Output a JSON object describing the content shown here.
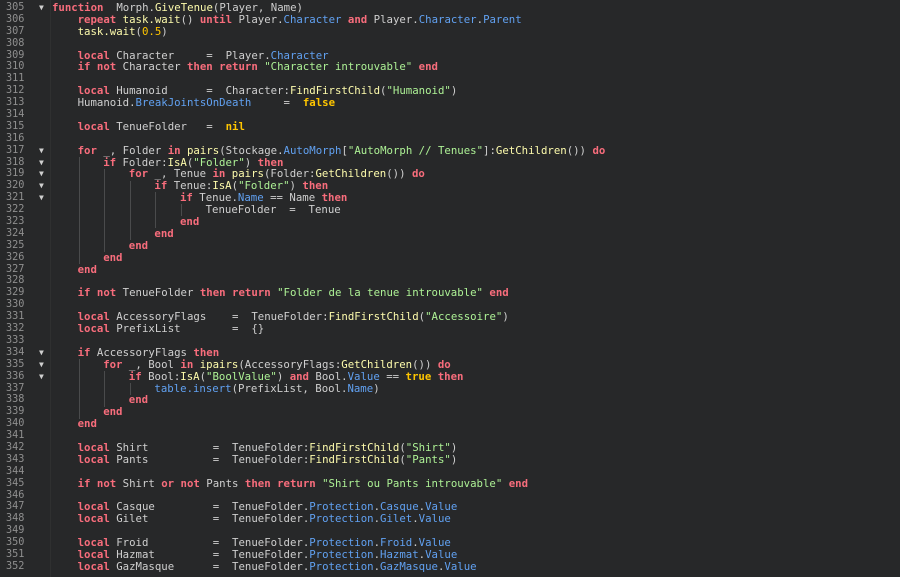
{
  "editor": {
    "lines": [
      {
        "n": "305",
        "fold": true,
        "indent": 0,
        "t": [
          [
            "kw",
            "function"
          ],
          [
            "",
            "  Morph."
          ],
          [
            "fn",
            "GiveTenue"
          ],
          [
            "",
            "(Player, Name)"
          ]
        ]
      },
      {
        "n": "306",
        "fold": false,
        "indent": 1,
        "t": [
          [
            "kw",
            "repeat"
          ],
          [
            "",
            " "
          ],
          [
            "fn",
            "task.wait"
          ],
          [
            "",
            "() "
          ],
          [
            "kw",
            "until"
          ],
          [
            "",
            " Player."
          ],
          [
            "prop",
            "Character"
          ],
          [
            "",
            " "
          ],
          [
            "kw",
            "and"
          ],
          [
            "",
            " Player."
          ],
          [
            "prop",
            "Character"
          ],
          [
            "",
            "."
          ],
          [
            "prop",
            "Parent"
          ]
        ]
      },
      {
        "n": "307",
        "fold": false,
        "indent": 1,
        "t": [
          [
            "fn",
            "task.wait"
          ],
          [
            "",
            "("
          ],
          [
            "num",
            "0.5"
          ],
          [
            "",
            ")"
          ]
        ]
      },
      {
        "n": "308",
        "fold": false,
        "indent": 0,
        "t": []
      },
      {
        "n": "309",
        "fold": false,
        "indent": 1,
        "t": [
          [
            "kw",
            "local"
          ],
          [
            "",
            " Character     =  Player."
          ],
          [
            "prop",
            "Character"
          ]
        ]
      },
      {
        "n": "310",
        "fold": false,
        "indent": 1,
        "t": [
          [
            "kw",
            "if not"
          ],
          [
            "",
            " Character "
          ],
          [
            "kw",
            "then return"
          ],
          [
            "",
            " "
          ],
          [
            "str",
            "\"Character introuvable\""
          ],
          [
            "",
            " "
          ],
          [
            "kw",
            "end"
          ]
        ]
      },
      {
        "n": "311",
        "fold": false,
        "indent": 0,
        "t": []
      },
      {
        "n": "312",
        "fold": false,
        "indent": 1,
        "t": [
          [
            "kw",
            "local"
          ],
          [
            "",
            " Humanoid      =  Character:"
          ],
          [
            "fn",
            "FindFirstChild"
          ],
          [
            "",
            "("
          ],
          [
            "str",
            "\"Humanoid\""
          ],
          [
            "",
            ")"
          ]
        ]
      },
      {
        "n": "313",
        "fold": false,
        "indent": 1,
        "t": [
          [
            "",
            "Humanoid."
          ],
          [
            "prop",
            "BreakJointsOnDeath"
          ],
          [
            "",
            "     =  "
          ],
          [
            "bool",
            "false"
          ]
        ]
      },
      {
        "n": "314",
        "fold": false,
        "indent": 0,
        "t": []
      },
      {
        "n": "315",
        "fold": false,
        "indent": 1,
        "t": [
          [
            "kw",
            "local"
          ],
          [
            "",
            " TenueFolder   =  "
          ],
          [
            "bool",
            "nil"
          ]
        ]
      },
      {
        "n": "316",
        "fold": false,
        "indent": 0,
        "t": []
      },
      {
        "n": "317",
        "fold": true,
        "indent": 1,
        "t": [
          [
            "kw",
            "for"
          ],
          [
            "",
            " _, Folder "
          ],
          [
            "kw",
            "in"
          ],
          [
            "",
            " "
          ],
          [
            "fn",
            "pairs"
          ],
          [
            "",
            "(Stockage."
          ],
          [
            "prop",
            "AutoMorph"
          ],
          [
            "",
            "["
          ],
          [
            "str",
            "\"AutoMorph // Tenues\""
          ],
          [
            "",
            "]:"
          ],
          [
            "fn",
            "GetChildren"
          ],
          [
            "",
            "()) "
          ],
          [
            "kw",
            "do"
          ]
        ]
      },
      {
        "n": "318",
        "fold": true,
        "indent": 2,
        "t": [
          [
            "kw",
            "if"
          ],
          [
            "",
            " Folder:"
          ],
          [
            "fn",
            "IsA"
          ],
          [
            "",
            "("
          ],
          [
            "str",
            "\"Folder\""
          ],
          [
            "",
            ") "
          ],
          [
            "kw",
            "then"
          ]
        ]
      },
      {
        "n": "319",
        "fold": true,
        "indent": 3,
        "t": [
          [
            "kw",
            "for"
          ],
          [
            "",
            " _, Tenue "
          ],
          [
            "kw",
            "in"
          ],
          [
            "",
            " "
          ],
          [
            "fn",
            "pairs"
          ],
          [
            "",
            "(Folder:"
          ],
          [
            "fn",
            "GetChildren"
          ],
          [
            "",
            "()) "
          ],
          [
            "kw",
            "do"
          ]
        ]
      },
      {
        "n": "320",
        "fold": true,
        "indent": 4,
        "t": [
          [
            "kw",
            "if"
          ],
          [
            "",
            " Tenue:"
          ],
          [
            "fn",
            "IsA"
          ],
          [
            "",
            "("
          ],
          [
            "str",
            "\"Folder\""
          ],
          [
            "",
            ") "
          ],
          [
            "kw",
            "then"
          ]
        ]
      },
      {
        "n": "321",
        "fold": true,
        "indent": 5,
        "t": [
          [
            "kw",
            "if"
          ],
          [
            "",
            " Tenue."
          ],
          [
            "prop",
            "Name"
          ],
          [
            "",
            " == Name "
          ],
          [
            "kw",
            "then"
          ]
        ]
      },
      {
        "n": "322",
        "fold": false,
        "indent": 6,
        "t": [
          [
            "",
            "TenueFolder  =  Tenue"
          ]
        ]
      },
      {
        "n": "323",
        "fold": false,
        "indent": 5,
        "t": [
          [
            "kw",
            "end"
          ]
        ]
      },
      {
        "n": "324",
        "fold": false,
        "indent": 4,
        "t": [
          [
            "kw",
            "end"
          ]
        ]
      },
      {
        "n": "325",
        "fold": false,
        "indent": 3,
        "t": [
          [
            "kw",
            "end"
          ]
        ]
      },
      {
        "n": "326",
        "fold": false,
        "indent": 2,
        "t": [
          [
            "kw",
            "end"
          ]
        ]
      },
      {
        "n": "327",
        "fold": false,
        "indent": 1,
        "t": [
          [
            "kw",
            "end"
          ]
        ]
      },
      {
        "n": "328",
        "fold": false,
        "indent": 0,
        "t": []
      },
      {
        "n": "329",
        "fold": false,
        "indent": 1,
        "t": [
          [
            "kw",
            "if not"
          ],
          [
            "",
            " TenueFolder "
          ],
          [
            "kw",
            "then return"
          ],
          [
            "",
            " "
          ],
          [
            "str",
            "\"Folder de la tenue introuvable\""
          ],
          [
            "",
            " "
          ],
          [
            "kw",
            "end"
          ]
        ]
      },
      {
        "n": "330",
        "fold": false,
        "indent": 0,
        "t": []
      },
      {
        "n": "331",
        "fold": false,
        "indent": 1,
        "t": [
          [
            "kw",
            "local"
          ],
          [
            "",
            " AccessoryFlags    =  TenueFolder:"
          ],
          [
            "fn",
            "FindFirstChild"
          ],
          [
            "",
            "("
          ],
          [
            "str",
            "\"Accessoire\""
          ],
          [
            "",
            ")"
          ]
        ]
      },
      {
        "n": "332",
        "fold": false,
        "indent": 1,
        "t": [
          [
            "kw",
            "local"
          ],
          [
            "",
            " PrefixList        =  {}"
          ]
        ]
      },
      {
        "n": "333",
        "fold": false,
        "indent": 0,
        "t": []
      },
      {
        "n": "334",
        "fold": true,
        "indent": 1,
        "t": [
          [
            "kw",
            "if"
          ],
          [
            "",
            " AccessoryFlags "
          ],
          [
            "kw",
            "then"
          ]
        ]
      },
      {
        "n": "335",
        "fold": true,
        "indent": 2,
        "t": [
          [
            "kw",
            "for"
          ],
          [
            "",
            " _, Bool "
          ],
          [
            "kw",
            "in"
          ],
          [
            "",
            " "
          ],
          [
            "fn",
            "ipairs"
          ],
          [
            "",
            "(AccessoryFlags:"
          ],
          [
            "fn",
            "GetChildren"
          ],
          [
            "",
            "()) "
          ],
          [
            "kw",
            "do"
          ]
        ]
      },
      {
        "n": "336",
        "fold": true,
        "indent": 3,
        "t": [
          [
            "kw",
            "if"
          ],
          [
            "",
            " Bool:"
          ],
          [
            "fn",
            "IsA"
          ],
          [
            "",
            "("
          ],
          [
            "str",
            "\"BoolValue\""
          ],
          [
            "",
            ") "
          ],
          [
            "kw",
            "and"
          ],
          [
            "",
            " Bool."
          ],
          [
            "prop",
            "Value"
          ],
          [
            "",
            " == "
          ],
          [
            "bool",
            "true"
          ],
          [
            "",
            " "
          ],
          [
            "kw",
            "then"
          ]
        ]
      },
      {
        "n": "337",
        "fold": false,
        "indent": 4,
        "t": [
          [
            "prop",
            "table.insert"
          ],
          [
            "",
            "(PrefixList, Bool."
          ],
          [
            "prop",
            "Name"
          ],
          [
            "",
            ")"
          ]
        ]
      },
      {
        "n": "338",
        "fold": false,
        "indent": 3,
        "t": [
          [
            "kw",
            "end"
          ]
        ]
      },
      {
        "n": "339",
        "fold": false,
        "indent": 2,
        "t": [
          [
            "kw",
            "end"
          ]
        ]
      },
      {
        "n": "340",
        "fold": false,
        "indent": 1,
        "t": [
          [
            "kw",
            "end"
          ]
        ]
      },
      {
        "n": "341",
        "fold": false,
        "indent": 0,
        "t": []
      },
      {
        "n": "342",
        "fold": false,
        "indent": 1,
        "t": [
          [
            "kw",
            "local"
          ],
          [
            "",
            " Shirt          =  TenueFolder:"
          ],
          [
            "fn",
            "FindFirstChild"
          ],
          [
            "",
            "("
          ],
          [
            "str",
            "\"Shirt\""
          ],
          [
            "",
            ")"
          ]
        ]
      },
      {
        "n": "343",
        "fold": false,
        "indent": 1,
        "t": [
          [
            "kw",
            "local"
          ],
          [
            "",
            " Pants          =  TenueFolder:"
          ],
          [
            "fn",
            "FindFirstChild"
          ],
          [
            "",
            "("
          ],
          [
            "str",
            "\"Pants\""
          ],
          [
            "",
            ")"
          ]
        ]
      },
      {
        "n": "344",
        "fold": false,
        "indent": 0,
        "t": []
      },
      {
        "n": "345",
        "fold": false,
        "indent": 1,
        "t": [
          [
            "kw",
            "if not"
          ],
          [
            "",
            " Shirt "
          ],
          [
            "kw",
            "or not"
          ],
          [
            "",
            " Pants "
          ],
          [
            "kw",
            "then return"
          ],
          [
            "",
            " "
          ],
          [
            "str",
            "\"Shirt ou Pants introuvable\""
          ],
          [
            "",
            " "
          ],
          [
            "kw",
            "end"
          ]
        ]
      },
      {
        "n": "346",
        "fold": false,
        "indent": 0,
        "t": []
      },
      {
        "n": "347",
        "fold": false,
        "indent": 1,
        "t": [
          [
            "kw",
            "local"
          ],
          [
            "",
            " Casque         =  TenueFolder."
          ],
          [
            "prop",
            "Protection"
          ],
          [
            "",
            "."
          ],
          [
            "prop",
            "Casque"
          ],
          [
            "",
            "."
          ],
          [
            "prop",
            "Value"
          ]
        ]
      },
      {
        "n": "348",
        "fold": false,
        "indent": 1,
        "t": [
          [
            "kw",
            "local"
          ],
          [
            "",
            " Gilet          =  TenueFolder."
          ],
          [
            "prop",
            "Protection"
          ],
          [
            "",
            "."
          ],
          [
            "prop",
            "Gilet"
          ],
          [
            "",
            "."
          ],
          [
            "prop",
            "Value"
          ]
        ]
      },
      {
        "n": "349",
        "fold": false,
        "indent": 0,
        "t": []
      },
      {
        "n": "350",
        "fold": false,
        "indent": 1,
        "t": [
          [
            "kw",
            "local"
          ],
          [
            "",
            " Froid          =  TenueFolder."
          ],
          [
            "prop",
            "Protection"
          ],
          [
            "",
            "."
          ],
          [
            "prop",
            "Froid"
          ],
          [
            "",
            "."
          ],
          [
            "prop",
            "Value"
          ]
        ]
      },
      {
        "n": "351",
        "fold": false,
        "indent": 1,
        "t": [
          [
            "kw",
            "local"
          ],
          [
            "",
            " Hazmat         =  TenueFolder."
          ],
          [
            "prop",
            "Protection"
          ],
          [
            "",
            "."
          ],
          [
            "prop",
            "Hazmat"
          ],
          [
            "",
            "."
          ],
          [
            "prop",
            "Value"
          ]
        ]
      },
      {
        "n": "352",
        "fold": false,
        "indent": 1,
        "t": [
          [
            "kw",
            "local"
          ],
          [
            "",
            " GazMasque      =  TenueFolder."
          ],
          [
            "prop",
            "Protection"
          ],
          [
            "",
            "."
          ],
          [
            "prop",
            "GazMasque"
          ],
          [
            "",
            "."
          ],
          [
            "prop",
            "Value"
          ]
        ]
      }
    ]
  }
}
